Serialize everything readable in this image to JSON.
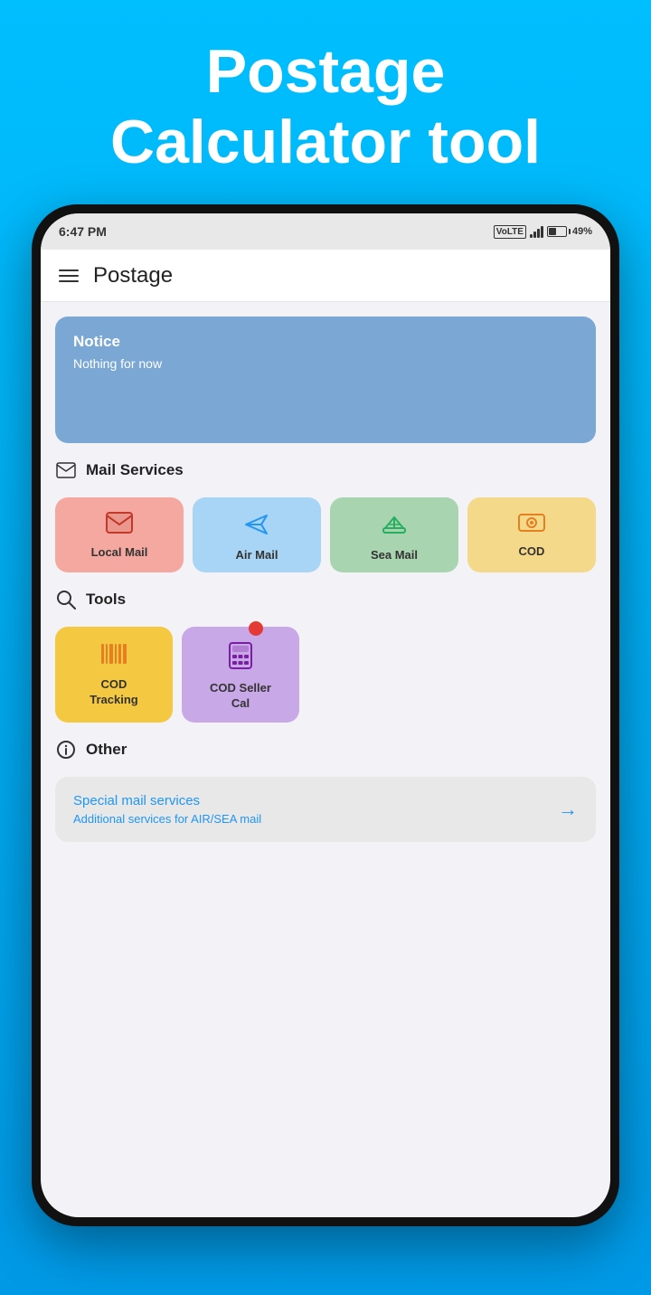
{
  "app": {
    "page_title_line1": "Postage",
    "page_title_line2": "Calculator tool",
    "screen_title": "Postage"
  },
  "status_bar": {
    "time": "6:47 PM",
    "battery_percent": "49%"
  },
  "notice": {
    "title": "Notice",
    "body": "Nothing for now"
  },
  "mail_services": {
    "section_label": "Mail Services",
    "items": [
      {
        "id": "local-mail",
        "label": "Local Mail",
        "color_class": "local"
      },
      {
        "id": "air-mail",
        "label": "Air Mail",
        "color_class": "air"
      },
      {
        "id": "sea-mail",
        "label": "Sea Mail",
        "color_class": "sea"
      },
      {
        "id": "cod",
        "label": "COD",
        "color_class": "cod"
      }
    ]
  },
  "tools": {
    "section_label": "Tools",
    "items": [
      {
        "id": "cod-tracking",
        "label": "COD\nTracking",
        "color_class": "cod-tracking",
        "has_notification": false
      },
      {
        "id": "cod-seller-cal",
        "label": "COD Seller\nCal",
        "color_class": "cod-seller",
        "has_notification": true
      }
    ]
  },
  "other": {
    "section_label": "Other",
    "special_card": {
      "title": "Special mail services",
      "subtitle": "Additional services for AIR/SEA mail"
    }
  }
}
